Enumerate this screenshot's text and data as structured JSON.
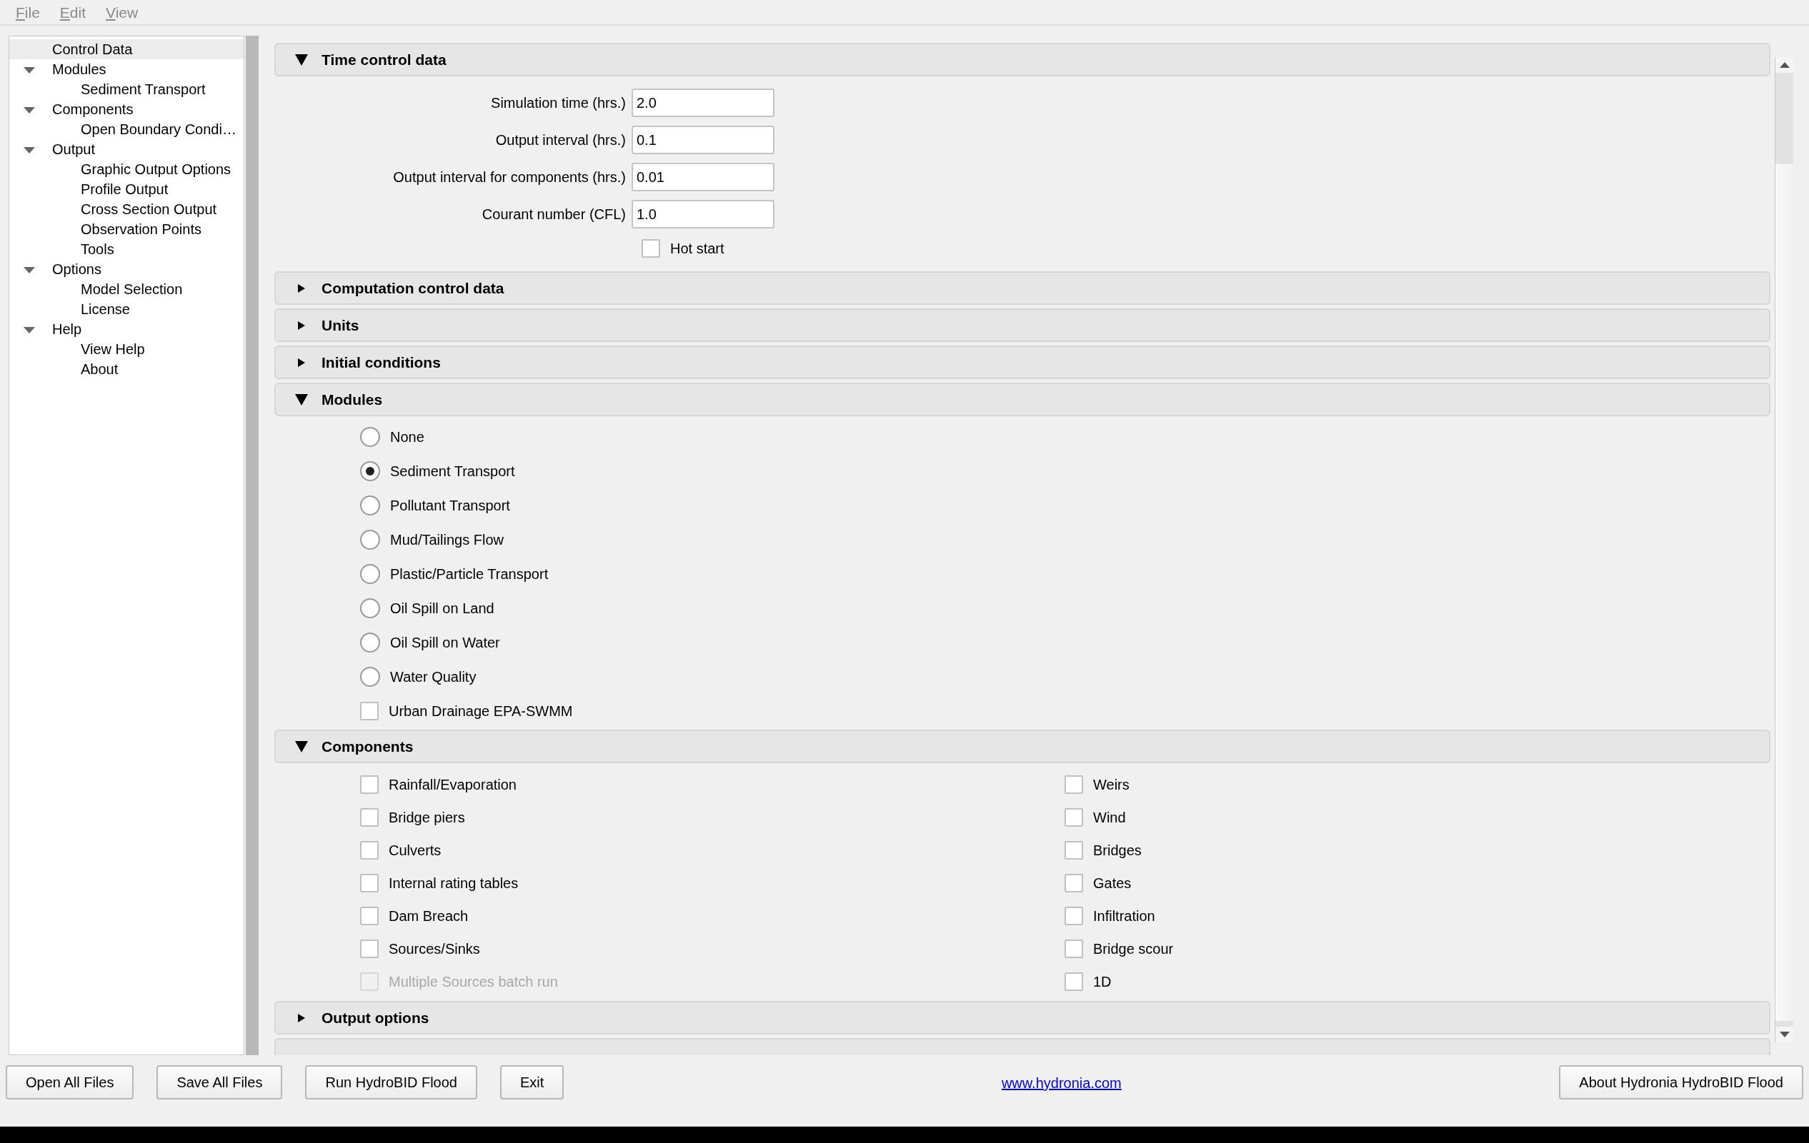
{
  "menu": [
    {
      "label": "File",
      "disabled": true
    },
    {
      "label": "Edit",
      "disabled": true
    },
    {
      "label": "View",
      "disabled": true
    }
  ],
  "tree": [
    {
      "label": "Control Data",
      "selected": true
    },
    {
      "label": "Modules",
      "selected": false,
      "expanded": true,
      "children": [
        {
          "label": "Sediment Transport",
          "selected": false
        }
      ]
    },
    {
      "label": "Components",
      "selected": false,
      "expanded": true,
      "children": [
        {
          "label": "Open Boundary Condi…",
          "selected": false
        }
      ]
    },
    {
      "label": "Output",
      "selected": false,
      "expanded": true,
      "children": [
        {
          "label": "Graphic Output Options",
          "selected": false
        },
        {
          "label": "Profile Output",
          "selected": false
        },
        {
          "label": "Cross Section Output",
          "selected": false
        },
        {
          "label": "Observation Points",
          "selected": false
        },
        {
          "label": "Tools",
          "selected": false
        }
      ]
    },
    {
      "label": "Options",
      "selected": false,
      "expanded": true,
      "children": [
        {
          "label": "Model Selection",
          "selected": false
        },
        {
          "label": "License",
          "selected": false
        }
      ]
    },
    {
      "label": "Help",
      "selected": false,
      "expanded": true,
      "children": [
        {
          "label": "View Help",
          "selected": false
        },
        {
          "label": "About",
          "selected": false
        }
      ]
    }
  ],
  "sections": [
    {
      "title": "Time control data",
      "expanded": true,
      "kind": "fields",
      "fields": [
        {
          "label": "Simulation time (hrs.)",
          "value": "2.0"
        },
        {
          "label": "Output interval (hrs.)",
          "value": "0.1"
        },
        {
          "label": "Output interval for components (hrs.)",
          "value": "0.01"
        },
        {
          "label": "Courant number (CFL)",
          "value": "1.0"
        }
      ],
      "checks": [
        {
          "label": "Hot start",
          "checked": false
        }
      ]
    },
    {
      "title": "Computation control data",
      "expanded": false
    },
    {
      "title": "Units",
      "expanded": false
    },
    {
      "title": "Initial conditions",
      "expanded": false
    },
    {
      "title": "Modules",
      "expanded": true,
      "kind": "options",
      "options": [
        {
          "kind": "radio",
          "label": "None",
          "selected": false
        },
        {
          "kind": "radio",
          "label": "Sediment Transport",
          "selected": true
        },
        {
          "kind": "radio",
          "label": "Pollutant Transport",
          "selected": false
        },
        {
          "kind": "radio",
          "label": "Mud/Tailings Flow",
          "selected": false
        },
        {
          "kind": "radio",
          "label": "Plastic/Particle Transport",
          "selected": false
        },
        {
          "kind": "radio",
          "label": "Oil Spill on Land",
          "selected": false
        },
        {
          "kind": "radio",
          "label": "Oil Spill on Water",
          "selected": false
        },
        {
          "kind": "radio",
          "label": "Water Quality",
          "selected": false
        },
        {
          "kind": "checkbox",
          "label": "Urban Drainage EPA-SWMM",
          "checked": false
        }
      ]
    },
    {
      "title": "Components",
      "expanded": true,
      "kind": "columns",
      "columns": [
        [
          {
            "label": "Rainfall/Evaporation",
            "checked": false,
            "disabled": false
          },
          {
            "label": "Bridge piers",
            "checked": false,
            "disabled": false
          },
          {
            "label": "Culverts",
            "checked": false,
            "disabled": false
          },
          {
            "label": "Internal rating tables",
            "checked": false,
            "disabled": false
          },
          {
            "label": "Dam Breach",
            "checked": false,
            "disabled": false
          },
          {
            "label": "Sources/Sinks",
            "checked": false,
            "disabled": false
          },
          {
            "label": "Multiple Sources batch run",
            "checked": false,
            "disabled": true
          }
        ],
        [
          {
            "label": "Weirs",
            "checked": false,
            "disabled": false
          },
          {
            "label": "Wind",
            "checked": false,
            "disabled": false
          },
          {
            "label": "Bridges",
            "checked": false,
            "disabled": false
          },
          {
            "label": "Gates",
            "checked": false,
            "disabled": false
          },
          {
            "label": "Infiltration",
            "checked": false,
            "disabled": false
          },
          {
            "label": "Bridge scour",
            "checked": false,
            "disabled": false
          },
          {
            "label": "1D",
            "checked": false,
            "disabled": false
          }
        ]
      ]
    },
    {
      "title": "Output options",
      "expanded": false
    }
  ],
  "footer": {
    "buttons_left": [
      "Open All Files",
      "Save All Files",
      "Run HydroBID Flood",
      "Exit"
    ],
    "link": "www.hydronia.com",
    "buttons_right": [
      "About Hydronia HydroBID Flood"
    ]
  }
}
